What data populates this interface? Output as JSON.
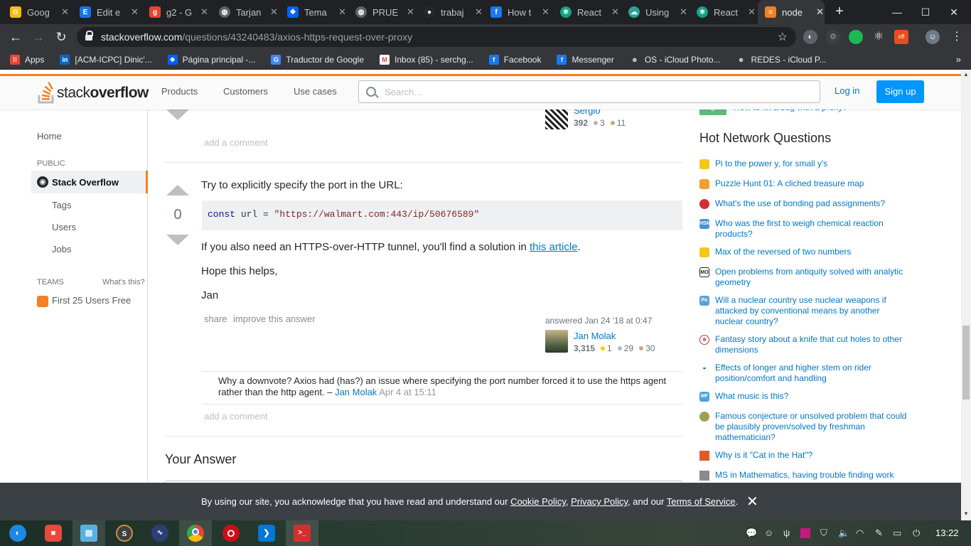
{
  "browser": {
    "tabs": [
      {
        "label": "Goog",
        "color": "#fbbc04",
        "icon": "G"
      },
      {
        "label": "Edit e",
        "color": "#1a73e8",
        "icon": "E"
      },
      {
        "label": "g2 - G",
        "color": "#ea4335",
        "icon": "g"
      },
      {
        "label": "Tarjan",
        "color": "#5f6368",
        "icon": "T"
      },
      {
        "label": "Tema",
        "color": "#0061fe",
        "icon": "D"
      },
      {
        "label": "PRUE",
        "color": "#5f6368",
        "icon": "P"
      },
      {
        "label": "trabaj",
        "color": "#24292e",
        "icon": "t"
      },
      {
        "label": "How t",
        "color": "#1877f2",
        "icon": "f"
      },
      {
        "label": "React",
        "color": "#16a085",
        "icon": "R"
      },
      {
        "label": "Using",
        "color": "#26a69a",
        "icon": "U"
      },
      {
        "label": "React",
        "color": "#16a085",
        "icon": "R"
      },
      {
        "label": "node",
        "color": "#f48024",
        "icon": "S"
      }
    ],
    "url_host": "stackoverflow.com",
    "url_path": "/questions/43240483/axios-https-request-over-proxy",
    "bookmarks": [
      {
        "label": "Apps",
        "color": "#ea4335",
        "icon": "::"
      },
      {
        "label": "[ACM-ICPC] Dinic'...",
        "color": "#0a66c2",
        "icon": "in"
      },
      {
        "label": "Página principal -...",
        "color": "#0061fe",
        "icon": "D"
      },
      {
        "label": "Traductor de Google",
        "color": "#4285f4",
        "icon": "G"
      },
      {
        "label": "Inbox (85) - serchg...",
        "color": "#ea4335",
        "icon": "M"
      },
      {
        "label": "Facebook",
        "color": "#1877f2",
        "icon": "f"
      },
      {
        "label": "Messenger",
        "color": "#1877f2",
        "icon": "f"
      },
      {
        "label": "OS - iCloud Photo...",
        "color": "#9aa0a6",
        "icon": ""
      },
      {
        "label": "REDES - iCloud P...",
        "color": "#9aa0a6",
        "icon": ""
      }
    ]
  },
  "header": {
    "logo_stack": "stack",
    "logo_overflow": "overflow",
    "nav": [
      "Products",
      "Customers",
      "Use cases"
    ],
    "search_placeholder": "Search…",
    "login": "Log in",
    "signup": "Sign up"
  },
  "sidebar": {
    "home": "Home",
    "public": "PUBLIC",
    "stack_overflow": "Stack Overflow",
    "tags": "Tags",
    "users": "Users",
    "jobs": "Jobs",
    "teams": "TEAMS",
    "whats_this": "What's this?",
    "first_users": "First 25 Users Free"
  },
  "prev_answer": {
    "user": "Sergio",
    "reputation": "392",
    "silver": "3",
    "bronze": "11",
    "add_comment": "add a comment"
  },
  "answer": {
    "votes": "0",
    "line1": "Try to explicitly specify the port in the URL:",
    "code_kw": "const",
    "code_mid": " url = ",
    "code_str": "\"https://walmart.com:443/ip/50676589\"",
    "line2_pre": "If you also need an HTTPS-over-HTTP tunnel, you'll find a solution in ",
    "line2_link": "this article",
    "line2_post": ".",
    "line3": "Hope this helps,",
    "line4": "Jan",
    "share": "share",
    "improve": "improve this answer",
    "answered": "answered Jan 24 '18 at 0:47",
    "user": "Jan Molak",
    "reputation": "3,315",
    "gold": "1",
    "silver": "29",
    "bronze": "30",
    "comment_text": "Why a downvote? Axios had (has?) an issue where specifying the port number forced it to use the https agent rather than the http agent. – ",
    "comment_user": "Jan Molak",
    "comment_date": " Apr 4 at 15:11",
    "add_comment": "add a comment"
  },
  "your_answer": "Your Answer",
  "related_partial": "How to fix a bug with a proxy?",
  "related_partial_count": "0",
  "hnq": {
    "title": "Hot Network Questions",
    "items": [
      {
        "text": "Pi to the power y, for small y's",
        "icon": "medal-icon",
        "color": "#f5c518"
      },
      {
        "text": "Puzzle Hunt 01: A cliched treasure map",
        "icon": "puzzle-icon",
        "color": "#f0a030"
      },
      {
        "text": "What's the use of bonding pad assignments?",
        "icon": "electronics-icon",
        "color": "#d32f2f"
      },
      {
        "text": "Who was the first to weigh chemical reaction products?",
        "icon": "hsm-icon",
        "color": "#4a90d9"
      },
      {
        "text": "Max of the reversed of two numbers",
        "icon": "medal-icon",
        "color": "#f5c518"
      },
      {
        "text": "Open problems from antiquity solved with analytic geometry",
        "icon": "mo-icon",
        "color": "#222222"
      },
      {
        "text": "Will a nuclear country use nuclear weapons if attacked by conventional means by another nuclear country?",
        "icon": "politics-icon",
        "color": "#5ea0d8"
      },
      {
        "text": "Fantasy story about a knife that cut holes to other dimensions",
        "icon": "scifi-icon",
        "color": "#b23a3a"
      },
      {
        "text": "Effects of longer and higher stem on rider position/comfort and handling",
        "icon": "bicycle-icon",
        "color": "#5a6b5a"
      },
      {
        "text": "What music is this?",
        "icon": "music-icon",
        "color": "#4aa3df"
      },
      {
        "text": "Famous conjecture or unsolved problem that could be plausibly proven/solved by freshman mathematician?",
        "icon": "math-icon",
        "color": "#a0a050"
      },
      {
        "text": "Why is it \"Cat in the Hat\"?",
        "icon": "bookmark-icon",
        "color": "#e05a2b"
      },
      {
        "text": "MS in Mathematics, having trouble finding work",
        "icon": "academia-icon",
        "color": "#8a8a8a"
      }
    ]
  },
  "cookie": {
    "pre": "By using our site, you acknowledge that you have read and understand our ",
    "cookie_policy": "Cookie Policy",
    "sep1": ", ",
    "privacy_policy": "Privacy Policy",
    "sep2": ", and our ",
    "terms": "Terms of Service",
    "post": ".",
    "close": "✕"
  },
  "taskbar": {
    "clock": "13:22"
  }
}
